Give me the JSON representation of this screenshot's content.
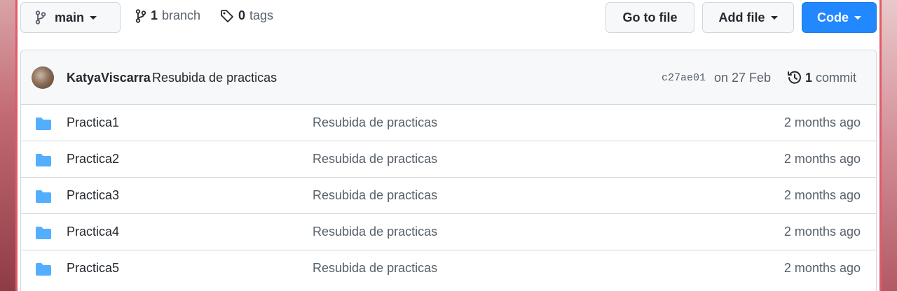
{
  "toolbar": {
    "branch_label": "main",
    "branches_count": "1",
    "branches_label": "branch",
    "tags_count": "0",
    "tags_label": "tags",
    "go_to_file": "Go to file",
    "add_file": "Add file",
    "code": "Code"
  },
  "commit": {
    "author": "KatyaViscarra",
    "message": "Resubida de practicas",
    "sha": "c27ae01",
    "date": "on 27 Feb",
    "commit_count": "1",
    "commit_label": "commit"
  },
  "files": [
    {
      "name": "Practica1",
      "message": "Resubida de practicas",
      "age": "2 months ago"
    },
    {
      "name": "Practica2",
      "message": "Resubida de practicas",
      "age": "2 months ago"
    },
    {
      "name": "Practica3",
      "message": "Resubida de practicas",
      "age": "2 months ago"
    },
    {
      "name": "Practica4",
      "message": "Resubida de practicas",
      "age": "2 months ago"
    },
    {
      "name": "Practica5",
      "message": "Resubida de practicas",
      "age": "2 months ago"
    }
  ],
  "colors": {
    "code_button": "#2188ff",
    "folder_icon": "#54aeff",
    "frame": "#e8707a"
  },
  "icons": {
    "branch": "git-branch-icon",
    "tag": "tag-icon",
    "history": "history-icon",
    "folder": "folder-icon"
  }
}
